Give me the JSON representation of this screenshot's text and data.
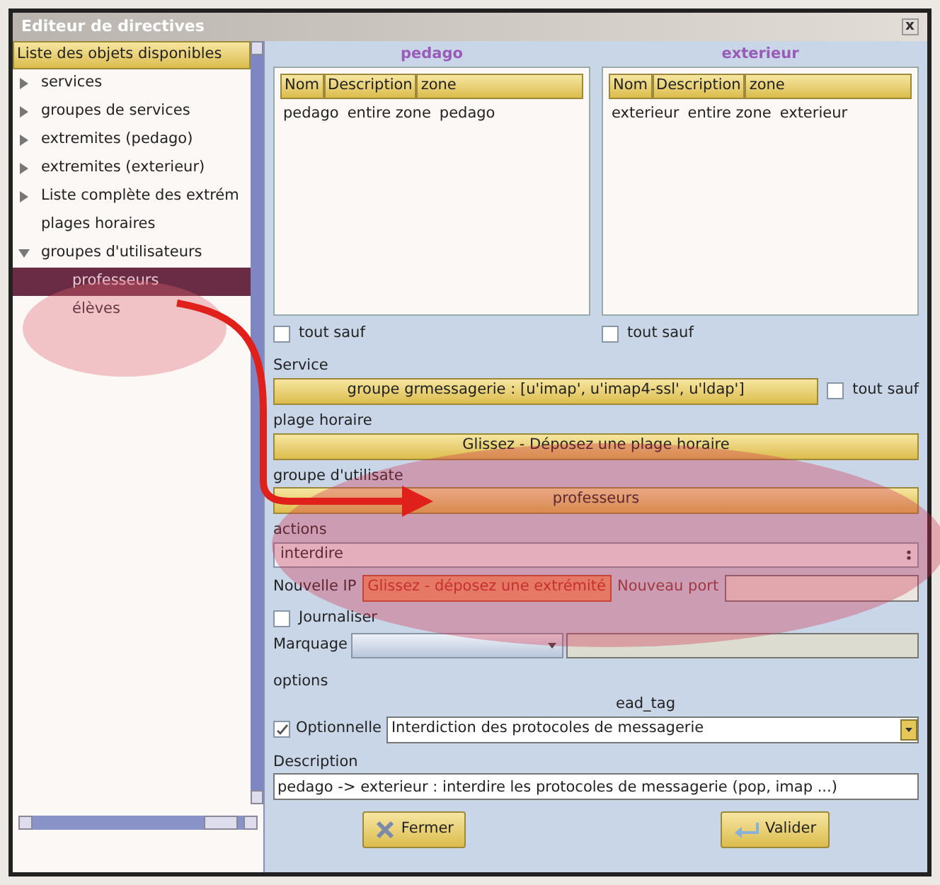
{
  "window": {
    "title": "Editeur de directives",
    "close": "x"
  },
  "sidebar": {
    "header": "Liste des objets disponibles",
    "items": [
      {
        "label": "services",
        "kind": "folder",
        "expanded": false
      },
      {
        "label": "groupes de services",
        "kind": "folder",
        "expanded": false
      },
      {
        "label": "extremites (pedago)",
        "kind": "folder",
        "expanded": false
      },
      {
        "label": "extremites (exterieur)",
        "kind": "folder",
        "expanded": false
      },
      {
        "label": "Liste complète des extrém",
        "kind": "folder",
        "expanded": false
      },
      {
        "label": "plages horaires",
        "kind": "leaf"
      },
      {
        "label": "groupes d'utilisateurs",
        "kind": "folder",
        "expanded": true,
        "children": [
          {
            "label": "professeurs",
            "selected": true
          },
          {
            "label": "élèves",
            "selected": false
          }
        ]
      }
    ]
  },
  "zones": [
    {
      "title": "pedago",
      "columns": [
        "Nom",
        "Description",
        "zone"
      ],
      "rows": [
        [
          "pedago",
          "entire zone",
          "pedago"
        ]
      ],
      "except_label": "tout sauf",
      "except_checked": false
    },
    {
      "title": "exterieur",
      "columns": [
        "Nom",
        "Description",
        "zone"
      ],
      "rows": [
        [
          "exterieur",
          "entire zone",
          "exterieur"
        ]
      ],
      "except_label": "tout sauf",
      "except_checked": false
    }
  ],
  "service": {
    "label": "Service",
    "value": "groupe grmessagerie : [u'imap', u'imap4-ssl', u'ldap']",
    "except_label": "tout sauf",
    "except_checked": false
  },
  "time_range": {
    "label": "plage horaire",
    "placeholder": "Glissez - Déposez une plage horaire"
  },
  "user_group": {
    "label": "groupe d'utilisate",
    "value": "professeurs"
  },
  "actions": {
    "label": "actions",
    "value": "interdire"
  },
  "new_ip": {
    "label": "Nouvelle IP",
    "placeholder": "Glissez - déposez une extrémité"
  },
  "new_port": {
    "label": "Nouveau port"
  },
  "log": {
    "label": "Journaliser",
    "checked": false
  },
  "marking": {
    "label": "Marquage"
  },
  "options": {
    "label": "options",
    "tag_label": "ead_tag",
    "optional_label": "Optionnelle",
    "optional_checked": true,
    "tag_value": "Interdiction des protocoles de messagerie"
  },
  "description": {
    "label": "Description",
    "value": "pedago -> exterieur : interdire les protocoles de messagerie (pop, imap ...)"
  },
  "buttons": [
    {
      "label": "Fermer",
      "kind": "close"
    },
    {
      "label": "Valider",
      "kind": "validate"
    }
  ]
}
